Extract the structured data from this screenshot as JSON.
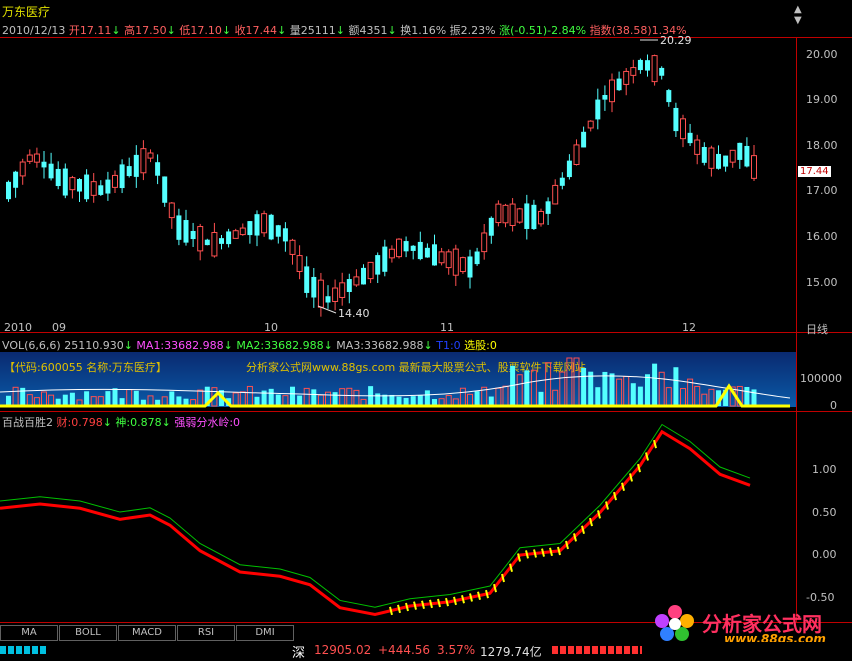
{
  "stock_name": "万东医疗",
  "info_bar": {
    "date": "2010/12/13",
    "open": "开17.11",
    "high": "高17.50",
    "low": "低17.10",
    "close": "收17.44",
    "volume": "量25111",
    "amount": "额4351",
    "turnover": "换1.16%",
    "amplitude": "振2.23%",
    "change": "涨(-0.51)-2.84%",
    "index_label": "指数",
    "index_value": "(38.58)1.34%"
  },
  "price_axis": [
    "20.00",
    "19.00",
    "18.00",
    "17.00",
    "16.00",
    "15.00"
  ],
  "price_current": "17.44",
  "annotation_high": "20.29",
  "annotation_low": "14.40",
  "time_axis": [
    "2010",
    "09",
    "10",
    "11",
    "12"
  ],
  "period_label": "日线",
  "vol_panel": {
    "label": "VOL(6,6,6)",
    "value": "25110.930",
    "ma1": "MA1:33682.988",
    "ma2": "MA2:33682.988",
    "ma3": "MA3:33682.988",
    "t1": "T1:0",
    "pick": "选股:0",
    "code_label": "【代码:600055 名称:万东医疗】",
    "ad_text": "分析家公式网www.88gs.com 最新最大股票公式、股票软件下载网站",
    "axis": [
      "100000",
      "0"
    ]
  },
  "indicator_panel": {
    "name": "百战百胜2",
    "cai": "财:0.798",
    "shen": "神:0.878",
    "strength": "强弱分水岭:0",
    "axis": [
      "1.00",
      "0.50",
      "0.00",
      "-0.50"
    ]
  },
  "tabs": [
    "MA",
    "BOLL",
    "MACD",
    "RSI",
    "DMI"
  ],
  "status_bar": {
    "market": "深",
    "index_value": "12905.02",
    "index_change": "+444.56",
    "index_pct": "3.57%",
    "index_amount": "1279.74亿"
  },
  "watermark": {
    "brand": "分析家公式网",
    "url": "www.88gs.com"
  },
  "colors": {
    "up": "#ff5050",
    "down": "#54ffff",
    "grid": "#c00000",
    "yellow": "#ffff00",
    "green": "#00c000",
    "red": "#ff0000",
    "magenta": "#ff50ff",
    "vol_bg": "#0a3a82"
  }
}
